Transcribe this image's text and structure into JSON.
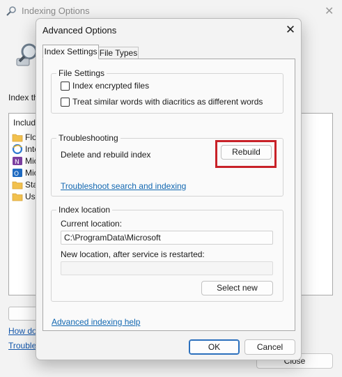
{
  "background_window": {
    "title": "Indexing Options",
    "index_text_partial": "Index th",
    "list_header_partial": "Include",
    "list_rows": [
      {
        "label": "Flov",
        "icon": "folder-icon"
      },
      {
        "label": "Inte",
        "icon": "internet-explorer-icon"
      },
      {
        "label": "Micr",
        "icon": "onenote-icon"
      },
      {
        "label": "Mic",
        "icon": "outlook-icon"
      },
      {
        "label": "Sta",
        "icon": "folder-icon"
      },
      {
        "label": "Use",
        "icon": "folder-icon"
      }
    ],
    "link_how_partial": "How doe",
    "link_troubleshoot_partial": "Troubles",
    "close_button": "Close"
  },
  "dialog": {
    "title": "Advanced Options",
    "tabs": [
      {
        "label": "Index Settings",
        "active": true
      },
      {
        "label": "File Types",
        "active": false
      }
    ],
    "file_settings": {
      "label": "File Settings",
      "options": [
        {
          "label": "Index encrypted files",
          "checked": false
        },
        {
          "label": "Treat similar words with diacritics as different words",
          "checked": false
        }
      ]
    },
    "troubleshooting": {
      "label": "Troubleshooting",
      "rebuild_text": "Delete and rebuild index",
      "rebuild_button": "Rebuild",
      "troubleshoot_link": "Troubleshoot search and indexing"
    },
    "index_location": {
      "label": "Index location",
      "current_label": "Current location:",
      "current_value": "C:\\ProgramData\\Microsoft",
      "new_label": "New location, after service is restarted:",
      "new_value": "",
      "select_new_button": "Select new"
    },
    "advanced_help_link": "Advanced indexing help",
    "ok_button": "OK",
    "cancel_button": "Cancel"
  },
  "colors": {
    "highlight": "#c82128",
    "link": "#1167b1",
    "primary_border": "#2a6fbd"
  }
}
